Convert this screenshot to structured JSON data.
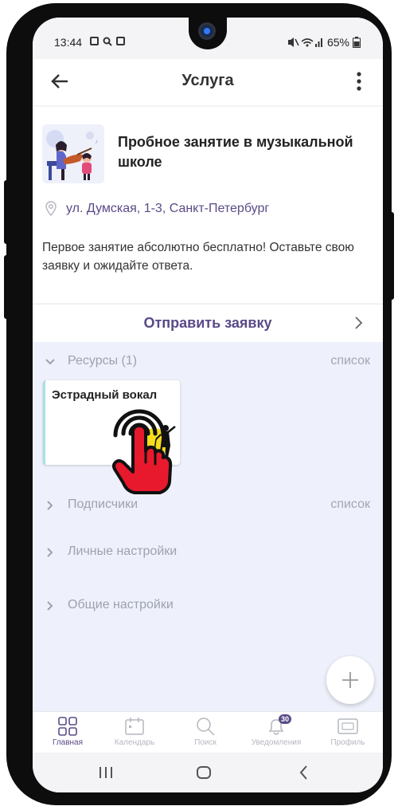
{
  "status_bar": {
    "time": "13:44",
    "battery": "65%"
  },
  "appbar": {
    "title": "Услуга"
  },
  "service": {
    "title": "Пробное занятие в музыкальной школе",
    "address": "ул. Думская, 1-3, Санкт-Петербург",
    "description": "Первое занятие абсолютно бесплатно! Оставьте свою заявку и ожидайте ответа.",
    "thumbnail_icon": "music-lesson-illustration"
  },
  "send_request": {
    "label": "Отправить заявку"
  },
  "sections": {
    "resources": {
      "label": "Ресурсы (1)",
      "link": "список"
    },
    "subscribers": {
      "label": "Подписчики",
      "link": "список"
    },
    "personal_settings": {
      "label": "Личные настройки"
    },
    "general_settings": {
      "label": "Общие настройки"
    }
  },
  "resource_card": {
    "title": "Эстрадный вокал",
    "image_icon": "singer-silhouette"
  },
  "bottom_nav": {
    "items": [
      {
        "label": "Главная",
        "icon": "grid-icon",
        "active": true
      },
      {
        "label": "Календарь",
        "icon": "calendar-icon",
        "active": false
      },
      {
        "label": "Поиск",
        "icon": "search-icon",
        "active": false
      },
      {
        "label": "Уведомления",
        "icon": "bell-icon",
        "active": false,
        "badge": "30"
      },
      {
        "label": "Профиль",
        "icon": "profile-card-icon",
        "active": false
      }
    ]
  },
  "colors": {
    "accent": "#5a4a87",
    "lower_background": "#eef1fb",
    "resource_border": "#a7e0e7",
    "tap_hand": "#e8192c"
  }
}
